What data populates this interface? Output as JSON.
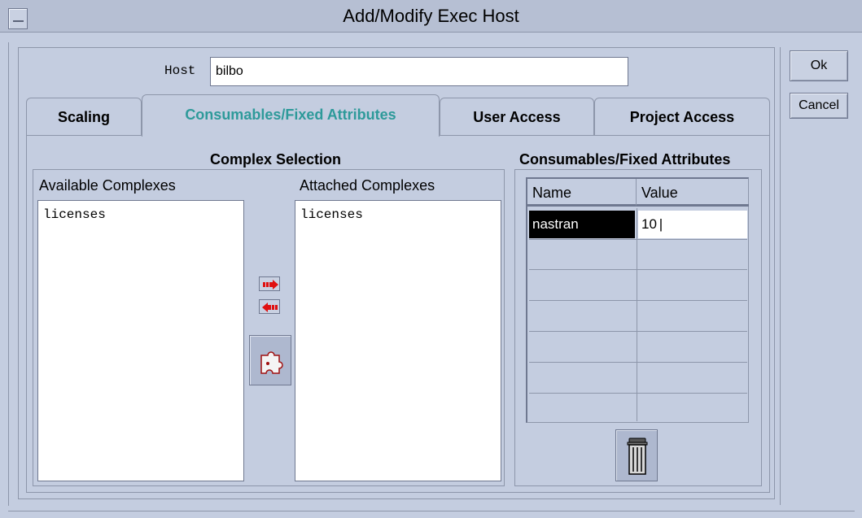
{
  "window": {
    "title": "Add/Modify Exec Host"
  },
  "host": {
    "label": "Host",
    "value": "bilbo"
  },
  "tabs": [
    {
      "label": "Scaling",
      "active": false
    },
    {
      "label": "Consumables/Fixed Attributes",
      "active": true
    },
    {
      "label": "User Access",
      "active": false
    },
    {
      "label": "Project Access",
      "active": false
    }
  ],
  "complex_selection": {
    "title": "Complex Selection",
    "available_label": "Available Complexes",
    "available_items": [
      "licenses"
    ],
    "attached_label": "Attached Complexes",
    "attached_items": [
      "licenses"
    ]
  },
  "consumables": {
    "title": "Consumables/Fixed Attributes",
    "columns": [
      "Name",
      "Value"
    ],
    "rows": [
      {
        "name": "nastran",
        "value": "10"
      }
    ]
  },
  "buttons": {
    "ok": "Ok",
    "cancel": "Cancel"
  },
  "icons": {
    "add": "right-arrow-icon",
    "remove": "left-arrow-icon",
    "config": "puzzle-icon",
    "delete": "trash-icon"
  },
  "colors": {
    "active_tab": "#2e9a9a",
    "arrow": "#e01010"
  }
}
